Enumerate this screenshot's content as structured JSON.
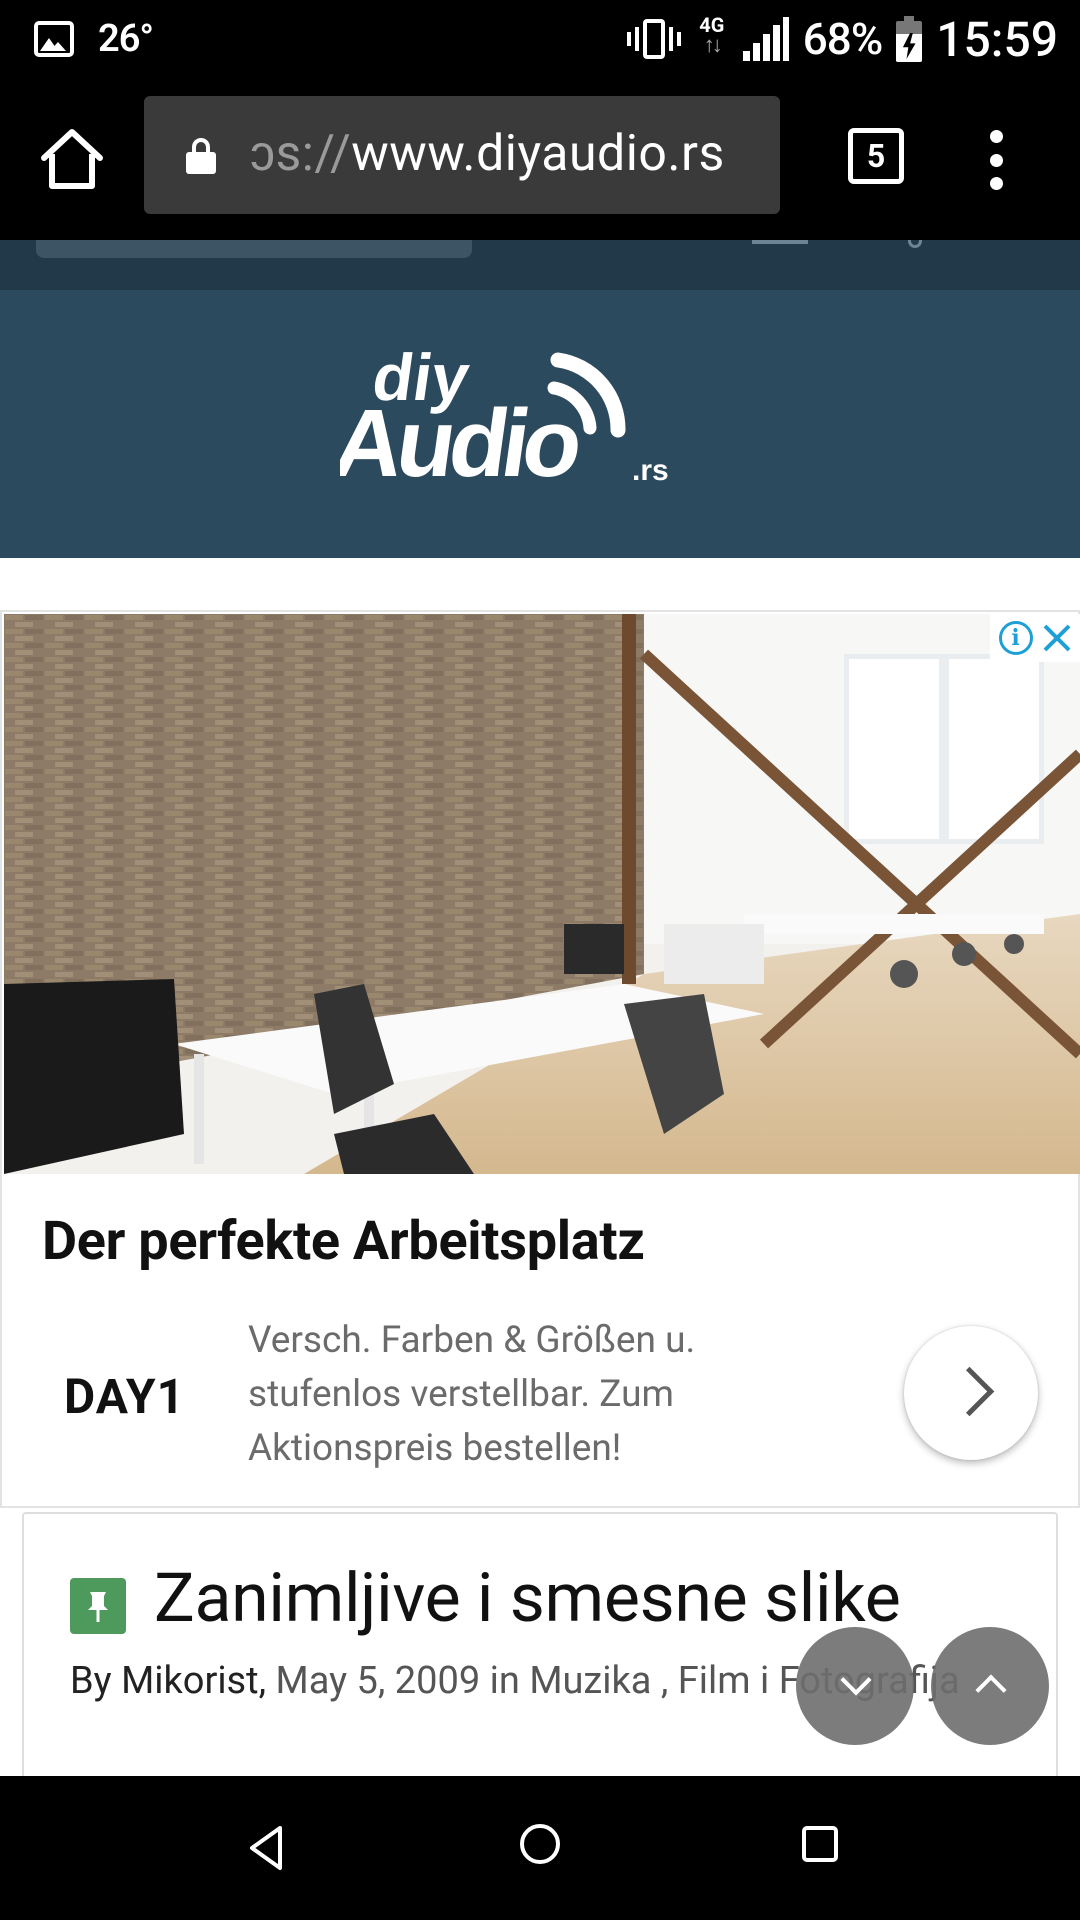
{
  "status_bar": {
    "temperature": "26°",
    "network": "4G",
    "battery_percent": "68%",
    "battery_level": 0.68,
    "time": "15:59"
  },
  "browser": {
    "url_scheme": "ɔs://",
    "url_host": "www.diyaudio.rs",
    "tab_count": "5",
    "icons": {
      "home": "home-icon",
      "lock": "lock-icon",
      "menu": "more-vert-icon"
    }
  },
  "site": {
    "logo_alt": "diyAudio.rs",
    "logo_text_top": "diy",
    "logo_text_main": "Audio",
    "logo_text_tld": ".rs",
    "header_color": "#2c4a5e"
  },
  "ad": {
    "headline": "Der perfekte Arbeitsplatz",
    "brand": "DAY1",
    "body": "Versch. Farben & Größen u. stufenlos verstellbar. Zum Aktionspreis bestellen!",
    "badges": [
      "info-icon",
      "close-icon"
    ],
    "accent_color": "#1ea0d6"
  },
  "topic": {
    "title": "Zanimljive i smesne slike",
    "by_label": "By",
    "author": "Mikorist,",
    "date": "May 5, 2009",
    "in_label": "in",
    "category": "Muzika , Film i Fotografija",
    "pin_color": "#4e9a5c"
  },
  "floating": {
    "scroll_down": "chevron-down-icon",
    "scroll_up": "chevron-up-icon"
  },
  "nav": {
    "back": "back-icon",
    "home": "home-circle-icon",
    "recents": "recents-icon"
  }
}
